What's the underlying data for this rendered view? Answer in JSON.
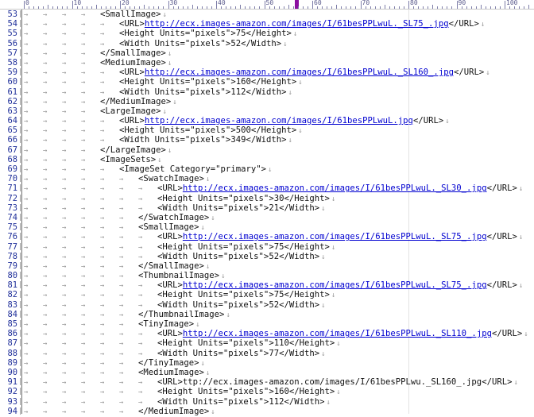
{
  "ruler": {
    "labels": [
      "0",
      "10",
      "20",
      "30",
      "40",
      "50",
      "60",
      "70",
      "80",
      "90",
      "100"
    ]
  },
  "symbols": {
    "tab": "→",
    "eol": "↓",
    "gutter_mark": "|"
  },
  "lines": [
    {
      "num": "53",
      "tabs": 4,
      "parts": [
        {
          "t": "<SmallImage>",
          "u": false
        }
      ]
    },
    {
      "num": "54",
      "tabs": 5,
      "parts": [
        {
          "t": "<URL>",
          "u": false
        },
        {
          "t": "http://ecx.images-amazon.com/images/I/61besPPLwuL._SL75_.jpg",
          "u": true
        },
        {
          "t": "</URL>",
          "u": false
        }
      ]
    },
    {
      "num": "55",
      "tabs": 5,
      "parts": [
        {
          "t": "<Height Units=\"pixels\">75</Height>",
          "u": false
        }
      ]
    },
    {
      "num": "56",
      "tabs": 5,
      "parts": [
        {
          "t": "<Width Units=\"pixels\">52</Width>",
          "u": false
        }
      ]
    },
    {
      "num": "57",
      "tabs": 4,
      "parts": [
        {
          "t": "</SmallImage>",
          "u": false
        }
      ]
    },
    {
      "num": "58",
      "tabs": 4,
      "parts": [
        {
          "t": "<MediumImage>",
          "u": false
        }
      ]
    },
    {
      "num": "59",
      "tabs": 5,
      "parts": [
        {
          "t": "<URL>",
          "u": false
        },
        {
          "t": "http://ecx.images-amazon.com/images/I/61besPPLwuL._SL160_.jpg",
          "u": true
        },
        {
          "t": "</URL>",
          "u": false
        }
      ]
    },
    {
      "num": "60",
      "tabs": 5,
      "parts": [
        {
          "t": "<Height Units=\"pixels\">160</Height>",
          "u": false
        }
      ]
    },
    {
      "num": "61",
      "tabs": 5,
      "parts": [
        {
          "t": "<Width Units=\"pixels\">112</Width>",
          "u": false
        }
      ]
    },
    {
      "num": "62",
      "tabs": 4,
      "parts": [
        {
          "t": "</MediumImage>",
          "u": false
        }
      ]
    },
    {
      "num": "63",
      "tabs": 4,
      "parts": [
        {
          "t": "<LargeImage>",
          "u": false
        }
      ]
    },
    {
      "num": "64",
      "tabs": 5,
      "parts": [
        {
          "t": "<URL>",
          "u": false
        },
        {
          "t": "http://ecx.images-amazon.com/images/I/61besPPLwuL.jpg",
          "u": true
        },
        {
          "t": "</URL>",
          "u": false
        }
      ]
    },
    {
      "num": "65",
      "tabs": 5,
      "parts": [
        {
          "t": "<Height Units=\"pixels\">500</Height>",
          "u": false
        }
      ]
    },
    {
      "num": "66",
      "tabs": 5,
      "parts": [
        {
          "t": "<Width Units=\"pixels\">349</Width>",
          "u": false
        }
      ]
    },
    {
      "num": "67",
      "tabs": 4,
      "parts": [
        {
          "t": "</LargeImage>",
          "u": false
        }
      ]
    },
    {
      "num": "68",
      "tabs": 4,
      "parts": [
        {
          "t": "<ImageSets>",
          "u": false
        }
      ]
    },
    {
      "num": "69",
      "tabs": 5,
      "parts": [
        {
          "t": "<ImageSet Category=\"primary\">",
          "u": false
        }
      ]
    },
    {
      "num": "70",
      "tabs": 6,
      "parts": [
        {
          "t": "<SwatchImage>",
          "u": false
        }
      ]
    },
    {
      "num": "71",
      "tabs": 7,
      "parts": [
        {
          "t": "<URL>",
          "u": false
        },
        {
          "t": "http://ecx.images-amazon.com/images/I/61besPPLwuL._SL30_.jpg",
          "u": true
        },
        {
          "t": "</URL>",
          "u": false
        }
      ]
    },
    {
      "num": "72",
      "tabs": 7,
      "parts": [
        {
          "t": "<Height Units=\"pixels\">30</Height>",
          "u": false
        }
      ]
    },
    {
      "num": "73",
      "tabs": 7,
      "parts": [
        {
          "t": "<Width Units=\"pixels\">21</Width>",
          "u": false
        }
      ]
    },
    {
      "num": "74",
      "tabs": 6,
      "parts": [
        {
          "t": "</SwatchImage>",
          "u": false
        }
      ]
    },
    {
      "num": "75",
      "tabs": 6,
      "parts": [
        {
          "t": "<SmallImage>",
          "u": false
        }
      ]
    },
    {
      "num": "76",
      "tabs": 7,
      "parts": [
        {
          "t": "<URL>",
          "u": false
        },
        {
          "t": "http://ecx.images-amazon.com/images/I/61besPPLwuL._SL75_.jpg",
          "u": true
        },
        {
          "t": "</URL>",
          "u": false
        }
      ]
    },
    {
      "num": "77",
      "tabs": 7,
      "parts": [
        {
          "t": "<Height Units=\"pixels\">75</Height>",
          "u": false
        }
      ]
    },
    {
      "num": "78",
      "tabs": 7,
      "parts": [
        {
          "t": "<Width Units=\"pixels\">52</Width>",
          "u": false
        }
      ]
    },
    {
      "num": "79",
      "tabs": 6,
      "parts": [
        {
          "t": "</SmallImage>",
          "u": false
        }
      ]
    },
    {
      "num": "80",
      "tabs": 6,
      "parts": [
        {
          "t": "<ThumbnailImage>",
          "u": false
        }
      ]
    },
    {
      "num": "81",
      "tabs": 7,
      "parts": [
        {
          "t": "<URL>",
          "u": false
        },
        {
          "t": "http://ecx.images-amazon.com/images/I/61besPPLwuL._SL75_.jpg",
          "u": true
        },
        {
          "t": "</URL>",
          "u": false
        }
      ]
    },
    {
      "num": "82",
      "tabs": 7,
      "parts": [
        {
          "t": "<Height Units=\"pixels\">75</Height>",
          "u": false
        }
      ]
    },
    {
      "num": "83",
      "tabs": 7,
      "parts": [
        {
          "t": "<Width Units=\"pixels\">52</Width>",
          "u": false
        }
      ]
    },
    {
      "num": "84",
      "tabs": 6,
      "parts": [
        {
          "t": "</ThumbnailImage>",
          "u": false
        }
      ]
    },
    {
      "num": "85",
      "tabs": 6,
      "parts": [
        {
          "t": "<TinyImage>",
          "u": false
        }
      ]
    },
    {
      "num": "86",
      "tabs": 7,
      "parts": [
        {
          "t": "<URL>",
          "u": false
        },
        {
          "t": "http://ecx.images-amazon.com/images/I/61besPPLwuL._SL110_.jpg",
          "u": true
        },
        {
          "t": "</URL>",
          "u": false
        }
      ]
    },
    {
      "num": "87",
      "tabs": 7,
      "parts": [
        {
          "t": "<Height Units=\"pixels\">110</Height>",
          "u": false
        }
      ]
    },
    {
      "num": "88",
      "tabs": 7,
      "parts": [
        {
          "t": "<Width Units=\"pixels\">77</Width>",
          "u": false
        }
      ]
    },
    {
      "num": "89",
      "tabs": 6,
      "parts": [
        {
          "t": "</TinyImage>",
          "u": false
        }
      ]
    },
    {
      "num": "90",
      "tabs": 6,
      "parts": [
        {
          "t": "<MediumImage>",
          "u": false
        }
      ]
    },
    {
      "num": "91",
      "tabs": 7,
      "parts": [
        {
          "t": "<URL>ttp://ecx.images-amazon.com/images/I/61besPPLwu._SL160_.jpg</URL>",
          "u": false
        }
      ]
    },
    {
      "num": "92",
      "tabs": 7,
      "parts": [
        {
          "t": "<Height Units=\"pixels\">160</Height>",
          "u": false
        }
      ]
    },
    {
      "num": "93",
      "tabs": 7,
      "parts": [
        {
          "t": "<Width Units=\"pixels\">112</Width>",
          "u": false
        }
      ]
    },
    {
      "num": "94",
      "tabs": 6,
      "parts": [
        {
          "t": "</MediumImage>",
          "u": false
        }
      ]
    }
  ],
  "colors": {
    "line_number": "#1f2f9a",
    "url": "#0000d0",
    "whitespace_marks": "#9a9a9a",
    "ruler_cursor": "#8b10a0"
  }
}
